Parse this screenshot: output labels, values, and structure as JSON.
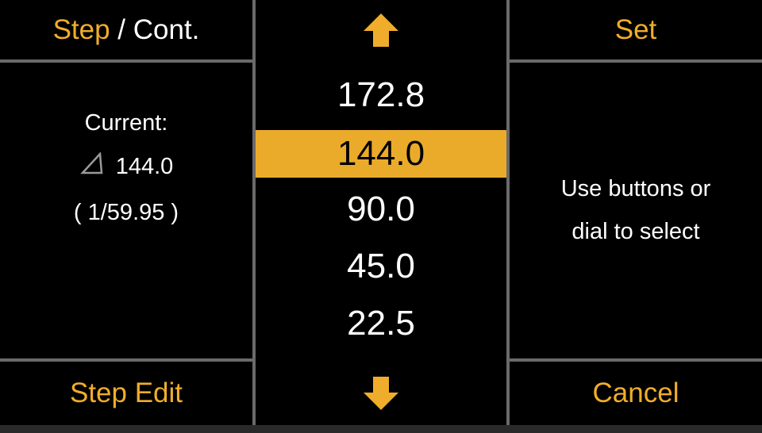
{
  "colors": {
    "accent": "#ebab2a",
    "background": "#000000",
    "divider": "#6a6a6a",
    "text": "#ffffff"
  },
  "left_panel": {
    "top_softkey": {
      "part1": "Step",
      "separator": " / Cont."
    },
    "current_label": "Current:",
    "current_icon": "shutter-angle-icon",
    "current_value": "144.0",
    "current_shutter": "( 1/59.95 )",
    "bottom_softkey": "Step Edit"
  },
  "center_panel": {
    "up_icon": "arrow-up-icon",
    "down_icon": "arrow-down-icon",
    "items": [
      {
        "label": "172.8",
        "selected": false
      },
      {
        "label": "144.0",
        "selected": true
      },
      {
        "label": "90.0",
        "selected": false
      },
      {
        "label": "45.0",
        "selected": false
      },
      {
        "label": "22.5",
        "selected": false
      }
    ]
  },
  "right_panel": {
    "top_softkey": "Set",
    "hint_line1": "Use buttons or",
    "hint_line2": "dial to select",
    "bottom_softkey": "Cancel"
  }
}
